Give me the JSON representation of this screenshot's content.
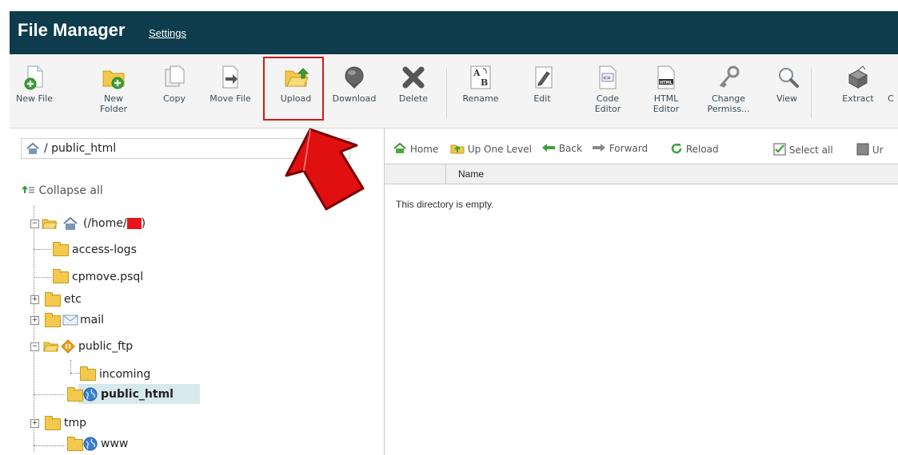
{
  "header": {
    "title": "File Manager",
    "settings_link": "Settings",
    "bg_color": "#0e3c4c"
  },
  "toolbar": {
    "buttons": [
      {
        "label": "New File",
        "icon": "new-file-icon"
      },
      {
        "label": "New\nFolder",
        "icon": "new-folder-icon"
      },
      {
        "label": "Copy",
        "icon": "copy-icon"
      },
      {
        "label": "Move File",
        "icon": "move-file-icon"
      },
      {
        "label": "Upload",
        "icon": "upload-icon",
        "highlighted": true
      },
      {
        "label": "Download",
        "icon": "download-icon"
      },
      {
        "label": "Delete",
        "icon": "delete-icon"
      },
      {
        "label": "Rename",
        "icon": "rename-icon"
      },
      {
        "label": "Edit",
        "icon": "edit-icon"
      },
      {
        "label": "Code\nEditor",
        "icon": "code-editor-icon"
      },
      {
        "label": "HTML\nEditor",
        "icon": "html-editor-icon"
      },
      {
        "label": "Change\nPermiss...",
        "icon": "change-permissions-icon"
      },
      {
        "label": "View",
        "icon": "view-icon"
      },
      {
        "label": "Extract",
        "icon": "extract-icon"
      },
      {
        "label": "C",
        "icon": "compress-icon"
      }
    ],
    "highlight_color": "#d11a1a"
  },
  "left": {
    "path": "/ public_html",
    "collapse_all": "Collapse all",
    "tree": [
      {
        "label": "(/home/",
        "suffix": ")",
        "redacted": true
      },
      {
        "label": "access-logs"
      },
      {
        "label": "cpmove.psql"
      },
      {
        "label": "etc"
      },
      {
        "label": "mail"
      },
      {
        "label": "public_ftp"
      },
      {
        "label": "incoming"
      },
      {
        "label": "public_html",
        "selected": true
      },
      {
        "label": "tmp"
      },
      {
        "label": "www"
      }
    ]
  },
  "right": {
    "nav": {
      "home": "Home",
      "up_one_level": "Up One Level",
      "back": "Back",
      "forward": "Forward",
      "reload": "Reload",
      "select_all": "Select all",
      "unselect": "Ur"
    },
    "column_name": "Name",
    "empty_message": "This directory is empty."
  }
}
